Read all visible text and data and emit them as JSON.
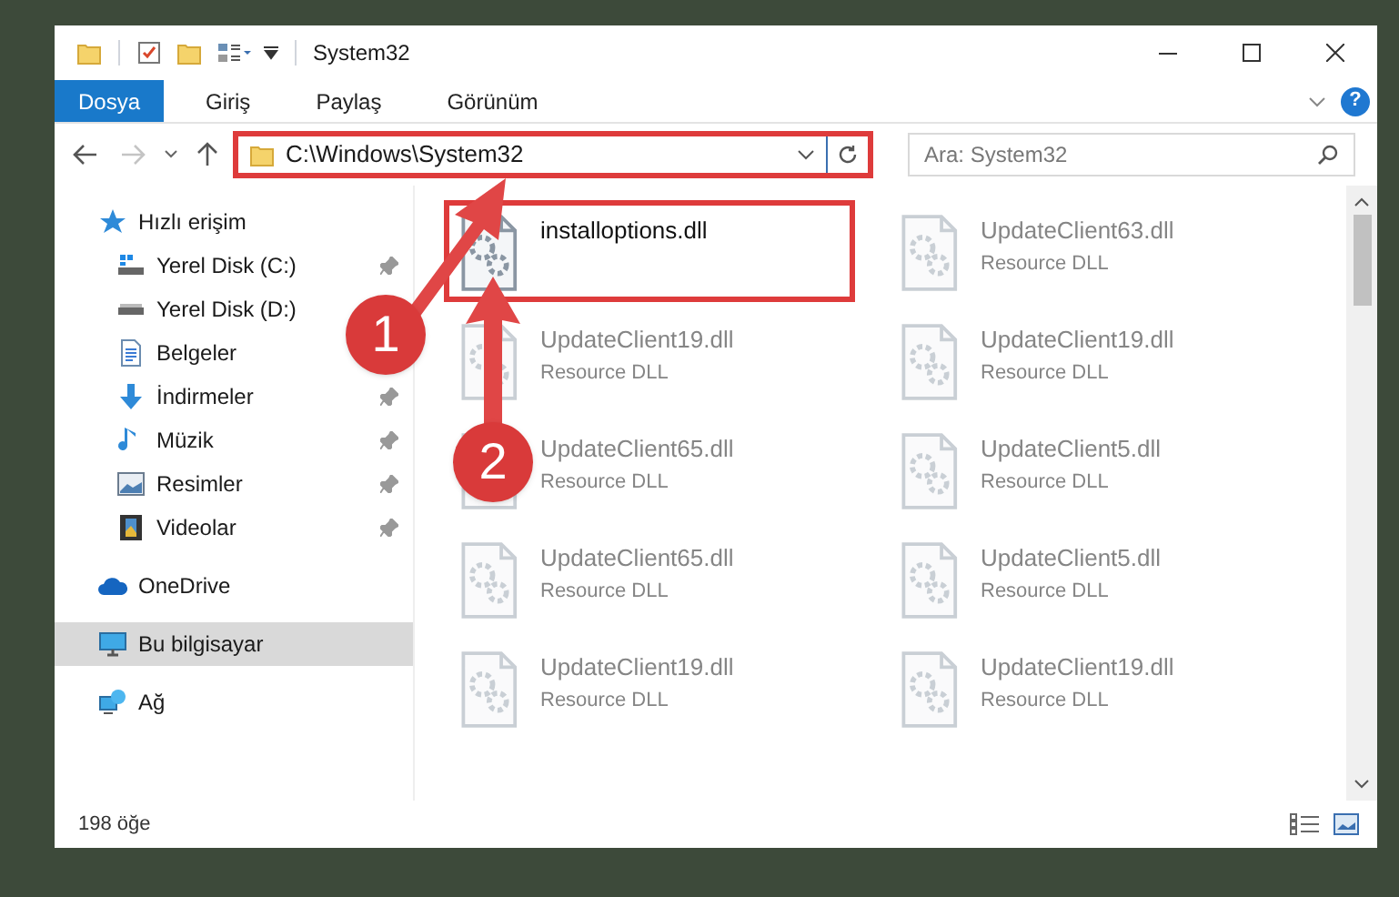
{
  "window": {
    "title": "System32",
    "help": "?"
  },
  "ribbon_tabs": [
    {
      "label": "Dosya",
      "selected": true
    },
    {
      "label": "Giriş",
      "selected": false
    },
    {
      "label": "Paylaş",
      "selected": false
    },
    {
      "label": "Görünüm",
      "selected": false
    }
  ],
  "address_bar": {
    "path": "C:\\Windows\\System32",
    "highlighted": true
  },
  "search": {
    "placeholder": "Ara: System32"
  },
  "sidebar": {
    "items": [
      {
        "label": "Hızlı erişim",
        "kind": "star",
        "selected": false,
        "children": [
          {
            "label": "Yerel Disk (C:)",
            "kind": "drive-c",
            "pinned": true
          },
          {
            "label": "Yerel Disk (D:)",
            "kind": "drive",
            "pinned": false
          },
          {
            "label": "Belgeler",
            "kind": "docs",
            "pinned": false
          },
          {
            "label": "İndirmeler",
            "kind": "download",
            "pinned": true
          },
          {
            "label": "Müzik",
            "kind": "music",
            "pinned": true
          },
          {
            "label": "Resimler",
            "kind": "pictures",
            "pinned": true
          },
          {
            "label": "Videolar",
            "kind": "video",
            "pinned": true
          }
        ]
      },
      {
        "label": "OneDrive",
        "kind": "cloud",
        "selected": false
      },
      {
        "label": "Bu bilgisayar",
        "kind": "computer",
        "selected": true
      },
      {
        "label": "Ağ",
        "kind": "network",
        "selected": false
      }
    ]
  },
  "files": [
    {
      "name": "installoptions.dll",
      "highlighted": true,
      "faded": false
    },
    {
      "name": "UpdateClient63.dll",
      "type": "Resource DLL",
      "highlighted": false,
      "faded": true
    },
    {
      "name": "UpdateClient19.dll",
      "type": "Resource DLL",
      "highlighted": false,
      "faded": true
    },
    {
      "name": "UpdateClient19.dll",
      "type": "Resource DLL",
      "highlighted": false,
      "faded": true
    },
    {
      "name": "UpdateClient65.dll",
      "type": "Resource DLL",
      "highlighted": false,
      "faded": true
    },
    {
      "name": "UpdateClient5.dll",
      "type": "Resource DLL",
      "highlighted": false,
      "faded": true
    },
    {
      "name": "UpdateClient65.dll",
      "type": "Resource DLL",
      "highlighted": false,
      "faded": true
    },
    {
      "name": "UpdateClient5.dll",
      "type": "Resource DLL",
      "highlighted": false,
      "faded": true
    },
    {
      "name": "UpdateClient19.dll",
      "type": "Resource DLL",
      "highlighted": false,
      "faded": true
    },
    {
      "name": "UpdateClient19.dll",
      "type": "Resource DLL",
      "highlighted": false,
      "faded": true
    }
  ],
  "status_bar": {
    "count": "198 öğe"
  },
  "annotations": [
    {
      "number": "1"
    },
    {
      "number": "2"
    }
  ]
}
